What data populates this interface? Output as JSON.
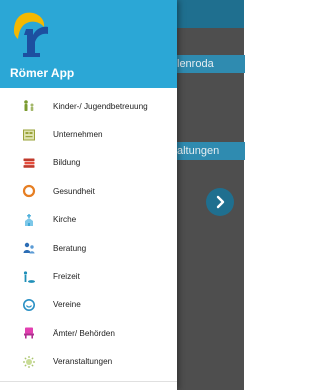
{
  "app": {
    "name": "Römer App"
  },
  "background": {
    "fragment_top": "lenroda",
    "fragment_mid": "altungen"
  },
  "menu": {
    "items": [
      {
        "label": "Kinder-/ Jugendbetreuung",
        "icon": "children-icon",
        "color": "#7a9a2e"
      },
      {
        "label": "Unternehmen",
        "icon": "company-icon",
        "color": "#9aa33a"
      },
      {
        "label": "Bildung",
        "icon": "books-icon",
        "color": "#c0392b"
      },
      {
        "label": "Gesundheit",
        "icon": "health-icon",
        "color": "#e67e22"
      },
      {
        "label": "Kirche",
        "icon": "church-icon",
        "color": "#3fa9d8"
      },
      {
        "label": "Beratung",
        "icon": "counseling-icon",
        "color": "#2c6db5"
      },
      {
        "label": "Freizeit",
        "icon": "leisure-icon",
        "color": "#1f8fb8"
      },
      {
        "label": "Vereine",
        "icon": "clubs-icon",
        "color": "#2a90c4"
      },
      {
        "label": "Ämter/ Behörden",
        "icon": "offices-icon",
        "color": "#e23fb0"
      },
      {
        "label": "Veranstaltungen",
        "icon": "events-icon",
        "color": "#a8c36a"
      }
    ]
  },
  "colors": {
    "header": "#2ba7d6",
    "logo_yellow": "#f5b800",
    "logo_blue": "#1d4fa0"
  }
}
